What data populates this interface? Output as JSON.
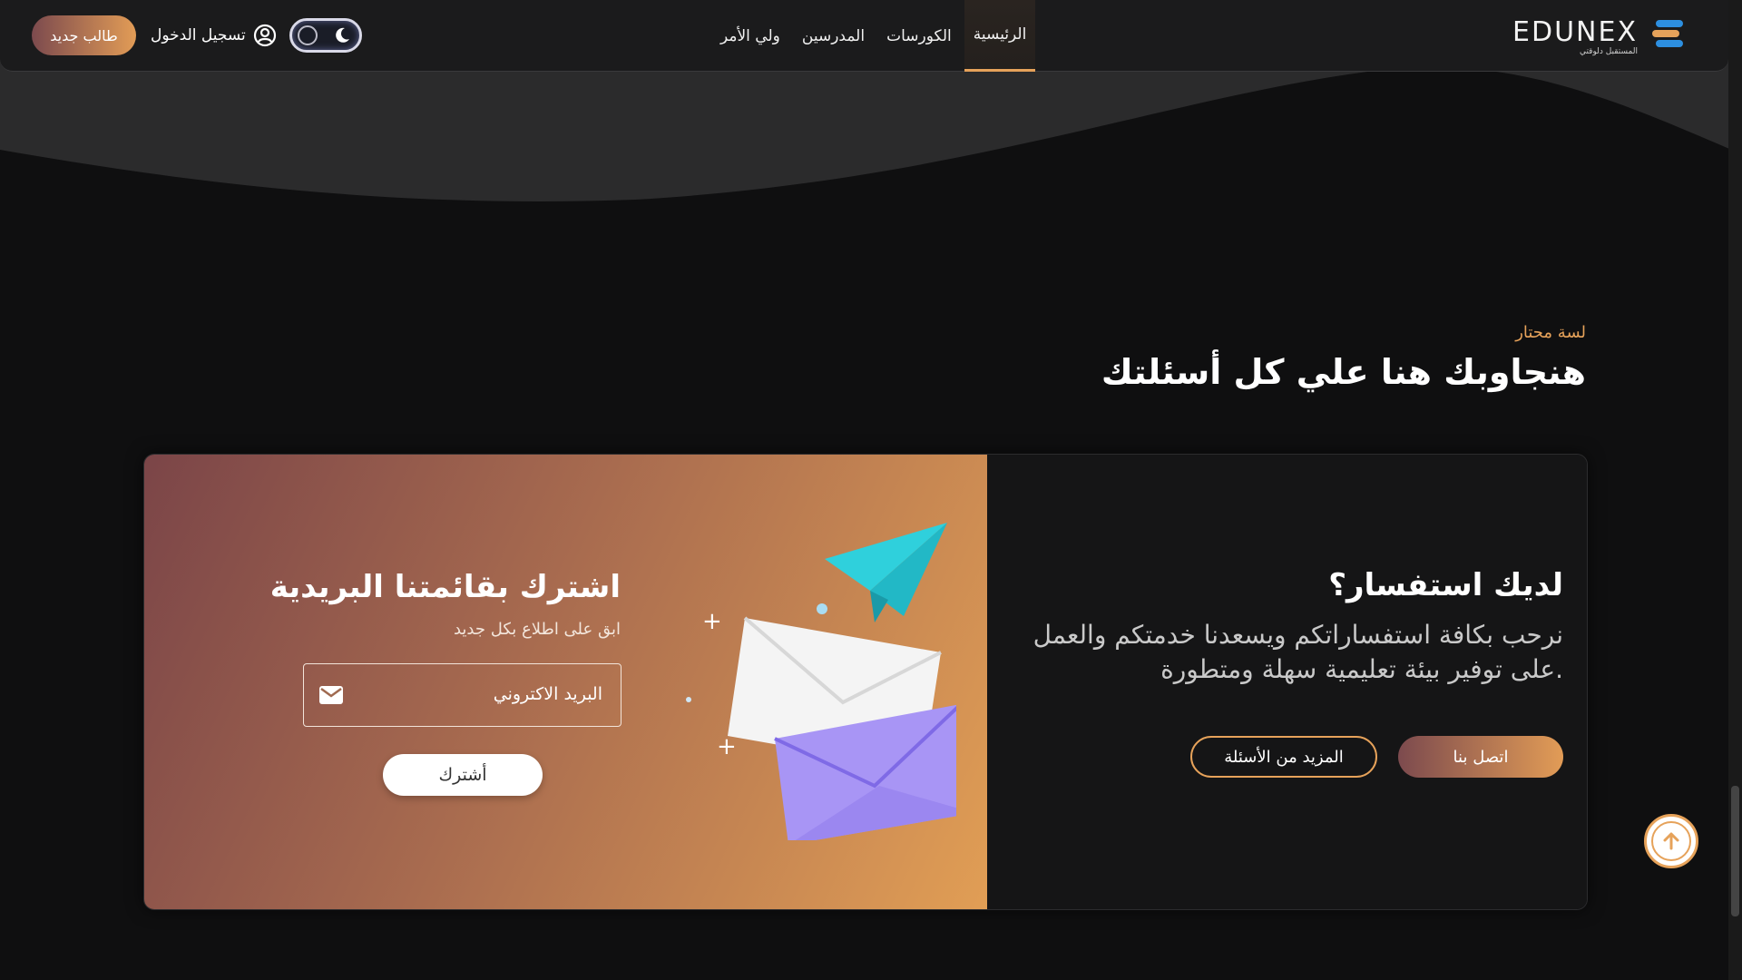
{
  "header": {
    "logo_text": "EDUNEX",
    "logo_tagline": "المستقبل دلوقتي",
    "nav": [
      {
        "label": "الرئيسية",
        "active": true
      },
      {
        "label": "الكورسات",
        "active": false
      },
      {
        "label": "المدرسين",
        "active": false
      },
      {
        "label": "ولي الأمر",
        "active": false
      }
    ],
    "login_label": "تسجيل الدخول",
    "new_student_label": "طالب جديد",
    "theme_toggle": {
      "mode": "dark"
    }
  },
  "section": {
    "eyebrow": "لسة محتار",
    "title": "هنجاوبك هنا علي كل أسئلتك"
  },
  "inquiry": {
    "title": "لديك استفسار؟",
    "text": "نرحب بكافة استفساراتكم ويسعدنا خدمتكم والعمل على توفير بيئة تعليمية سهلة ومتطورة.",
    "contact_button": "اتصل بنا",
    "faq_button": "المزيد من الأسئلة"
  },
  "newsletter": {
    "title": "اشترك بقائمتنا البريدية",
    "subtitle": "ابق على اطلاع بكل جديد",
    "email_placeholder": "البريد الاكتروني",
    "subscribe_button": "أشترك"
  },
  "colors": {
    "accent": "#e6a25a",
    "gradient_start": "#7c4a4e",
    "gradient_end": "#e29c56",
    "background": "#0f0f10"
  }
}
